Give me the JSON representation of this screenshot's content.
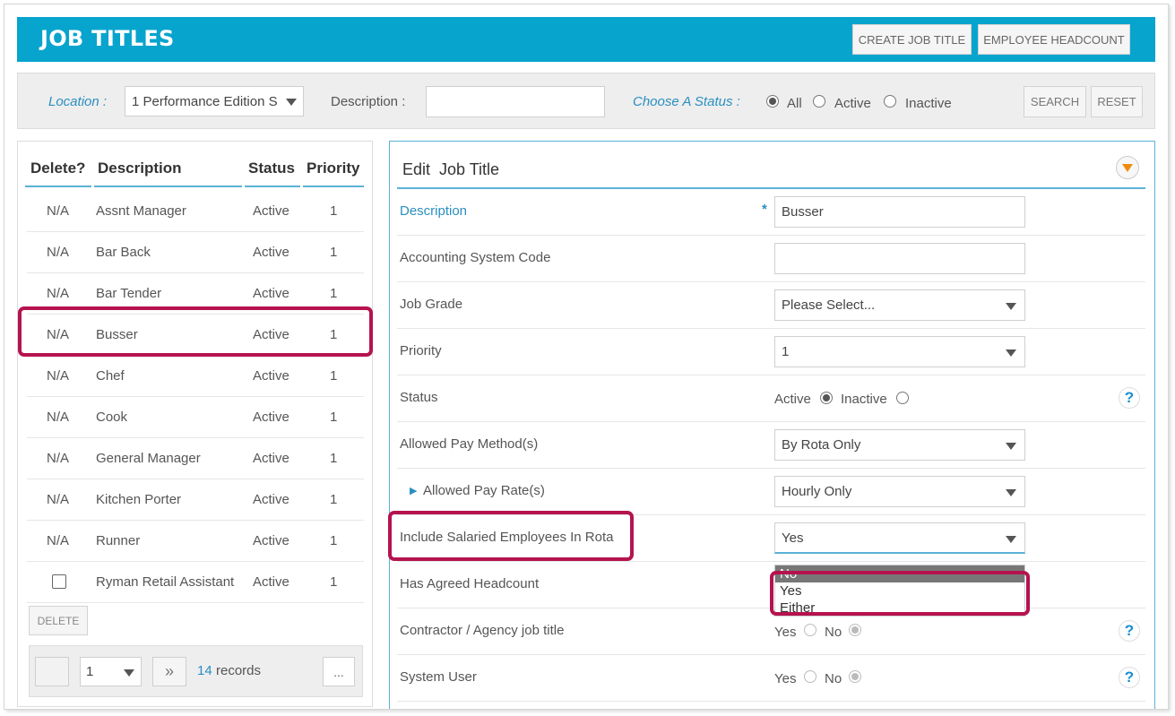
{
  "header": {
    "title": "JOB TITLES",
    "create_button": "CREATE JOB TITLE",
    "headcount_button": "EMPLOYEE HEADCOUNT"
  },
  "filter": {
    "location_label": "Location :",
    "location_value": "1 Performance Edition S",
    "description_label": "Description :",
    "description_value": "",
    "status_label": "Choose A Status :",
    "status_options": [
      "All",
      "Active",
      "Inactive"
    ],
    "status_selected": "All",
    "search_button": "SEARCH",
    "reset_button": "RESET"
  },
  "list": {
    "columns": [
      "Delete?",
      "Description",
      "Status",
      "Priority"
    ],
    "rows": [
      {
        "delete": "N/A",
        "description": "Assnt Manager",
        "status": "Active",
        "priority": "1"
      },
      {
        "delete": "N/A",
        "description": "Bar Back",
        "status": "Active",
        "priority": "1"
      },
      {
        "delete": "N/A",
        "description": "Bar Tender",
        "status": "Active",
        "priority": "1"
      },
      {
        "delete": "N/A",
        "description": "Busser",
        "status": "Active",
        "priority": "1"
      },
      {
        "delete": "N/A",
        "description": "Chef",
        "status": "Active",
        "priority": "1"
      },
      {
        "delete": "N/A",
        "description": "Cook",
        "status": "Active",
        "priority": "1"
      },
      {
        "delete": "N/A",
        "description": "General Manager",
        "status": "Active",
        "priority": "1"
      },
      {
        "delete": "N/A",
        "description": "Kitchen Porter",
        "status": "Active",
        "priority": "1"
      },
      {
        "delete": "N/A",
        "description": "Runner",
        "status": "Active",
        "priority": "1"
      },
      {
        "delete": "",
        "description": "Ryman Retail Assistant",
        "status": "Active",
        "priority": "1"
      }
    ],
    "delete_button": "DELETE",
    "pager": {
      "page_value": "1",
      "next_label": "»",
      "record_count": "14",
      "records_label": "records",
      "more_label": "..."
    }
  },
  "edit": {
    "title": "Edit  Job Title",
    "required_mark": "*",
    "fields": {
      "description": {
        "label": "Description",
        "value": "Busser"
      },
      "accounting_code": {
        "label": "Accounting System Code",
        "value": ""
      },
      "job_grade": {
        "label": "Job Grade",
        "value": "Please Select..."
      },
      "priority": {
        "label": "Priority",
        "value": "1"
      },
      "status": {
        "label": "Status",
        "options": [
          "Active",
          "Inactive"
        ],
        "selected": "Active"
      },
      "pay_method": {
        "label": "Allowed Pay Method(s)",
        "value": "By Rota Only"
      },
      "pay_rate": {
        "label": "Allowed Pay Rate(s)",
        "value": "Hourly Only"
      },
      "salaried": {
        "label": "Include Salaried Employees In Rota",
        "value": "Yes"
      },
      "headcount": {
        "label": "Has Agreed Headcount"
      },
      "contractor": {
        "label": "Contractor / Agency job title",
        "options": [
          "Yes",
          "No"
        ],
        "selected": "No"
      },
      "system_user": {
        "label": "System User",
        "options": [
          "Yes",
          "No"
        ],
        "selected": "No"
      }
    },
    "dropdown_options": [
      "No",
      "Yes",
      "Either"
    ],
    "dropdown_highlighted": "No",
    "help_label": "?"
  },
  "colors": {
    "header_bg": "#07a4cd",
    "accent_line": "#5ab2d6",
    "label_blue": "#2a8fc0",
    "highlight": "#b5134f",
    "collapse_arrow": "#f08b12"
  }
}
